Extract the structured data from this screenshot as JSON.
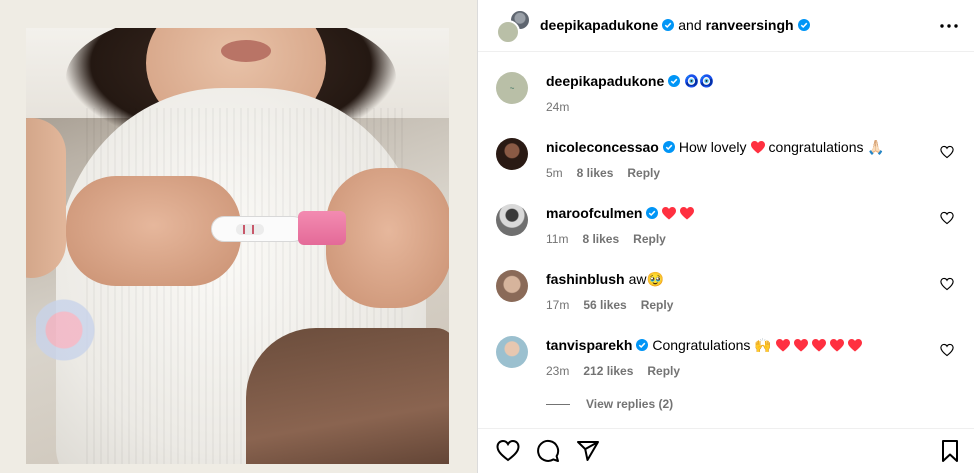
{
  "header": {
    "author": "deepikapadukone",
    "connector": "and",
    "coauthor": "ranveersingh",
    "more_icon": "more-horizontal-icon"
  },
  "caption": {
    "username": "deepikapadukone",
    "text": "🧿🧿",
    "time": "24m"
  },
  "comments": [
    {
      "username": "nicoleconcessao",
      "verified": true,
      "text_before": "How lovely",
      "text_after": "congratulations 🙏🏻",
      "hearts": 1,
      "time": "5m",
      "likes": "8 likes",
      "reply": "Reply"
    },
    {
      "username": "maroofculmen",
      "verified": true,
      "text_before": "",
      "text_after": "",
      "hearts": 2,
      "time": "11m",
      "likes": "8 likes",
      "reply": "Reply"
    },
    {
      "username": "fashinblush",
      "verified": false,
      "text_before": "aw🥹",
      "text_after": "",
      "hearts": 0,
      "time": "17m",
      "likes": "56 likes",
      "reply": "Reply"
    },
    {
      "username": "tanvisparekh",
      "verified": true,
      "text_before": "Congratulations 🙌",
      "text_after": "",
      "hearts": 5,
      "time": "23m",
      "likes": "212 likes",
      "reply": "Reply"
    }
  ],
  "view_replies": "View replies (2)",
  "colors": {
    "verified": "#0095f6",
    "heart": "#ff3040",
    "muted": "#737373"
  }
}
